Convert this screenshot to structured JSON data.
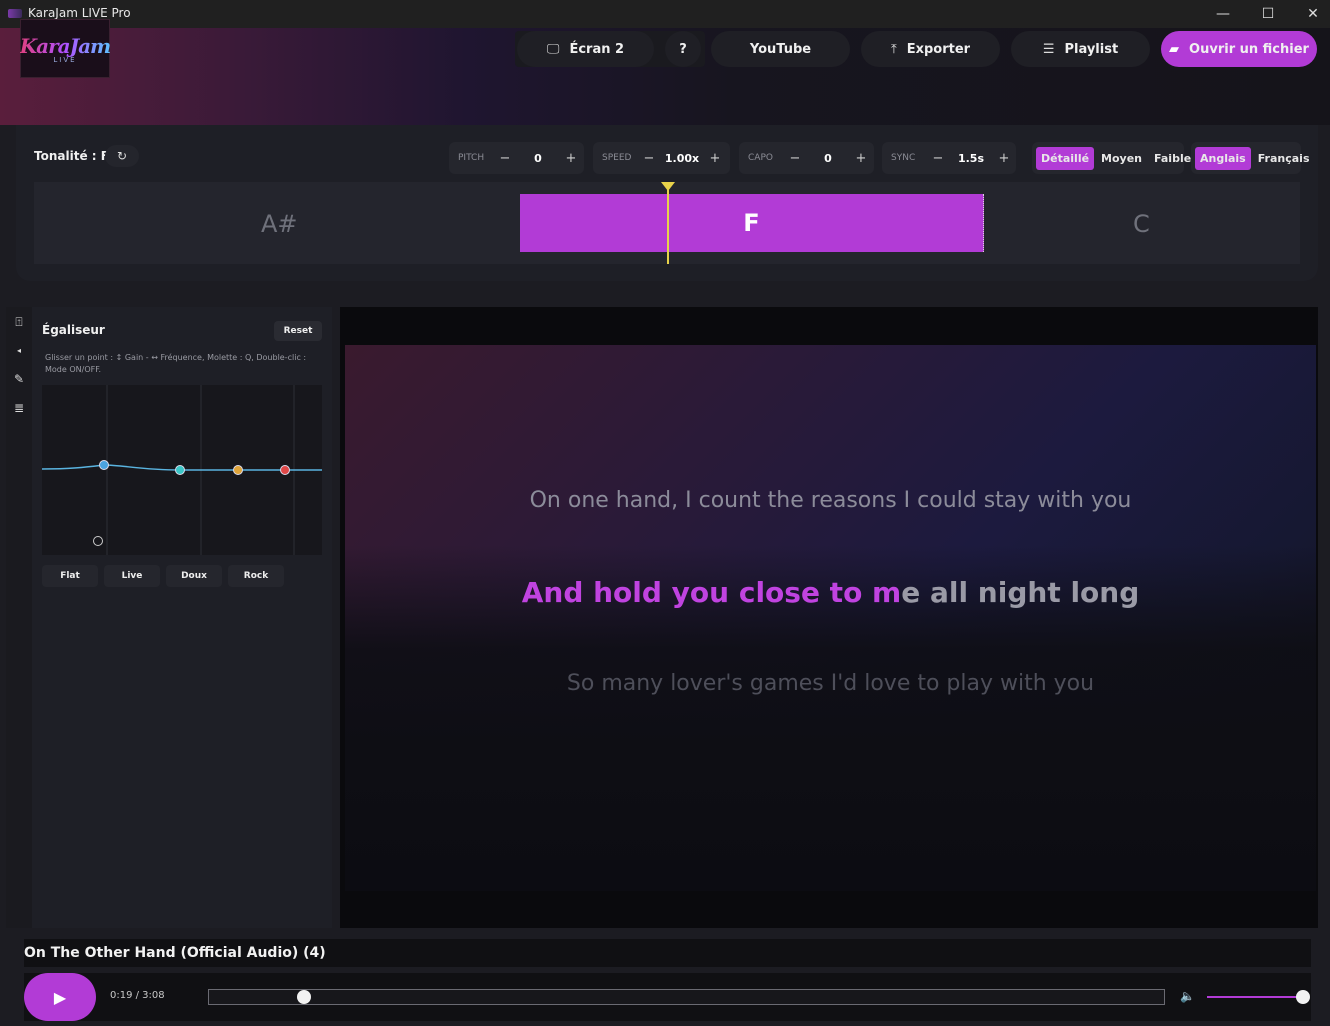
{
  "window": {
    "title": "KaraJam LIVE Pro",
    "minimize": "—",
    "maximize": "☐",
    "close": "✕"
  },
  "logo": {
    "line1": "KaraJam",
    "line2": "LIVE"
  },
  "header": {
    "screen_label": "Écran 2",
    "help_label": "?",
    "youtube_label": "YouTube",
    "export_label": "Exporter",
    "playlist_label": "Playlist",
    "open_label": "Ouvrir un fichier"
  },
  "controls": {
    "tonalite": "Tonalité : F",
    "pitch": {
      "label": "PITCH",
      "value": "0"
    },
    "speed": {
      "label": "SPEED",
      "value": "1.00x"
    },
    "capo": {
      "label": "CAPO",
      "value": "0"
    },
    "sync": {
      "label": "SYNC",
      "value": "1.5s"
    },
    "minus": "−",
    "plus": "+",
    "detail_levels": [
      "Détaillé",
      "Moyen",
      "Faible"
    ],
    "detail_selected": "Détaillé",
    "languages": [
      "Anglais",
      "Français"
    ],
    "language_selected": "Anglais"
  },
  "keys": {
    "prev": "A#",
    "current": "F",
    "next": "C"
  },
  "equalizer": {
    "title": "Égaliseur",
    "reset": "Reset",
    "help": "Glisser un point : ↕ Gain - ↔ Fréquence, Molette : Q, Double-clic : Mode ON/OFF.",
    "presets": [
      "Flat",
      "Live",
      "Doux",
      "Rock"
    ],
    "bands": [
      {
        "color": "#4aa3e0"
      },
      {
        "color": "#3bc7c7"
      },
      {
        "color": "#e0a53b"
      },
      {
        "color": "#e04848"
      }
    ]
  },
  "lyrics": {
    "previous": "On one hand, I count the reasons I could stay with you",
    "current_sung": "And hold you close to m",
    "current_rest": "e all night long",
    "next": "So many lover's games I'd love to play with you"
  },
  "player": {
    "song_title": "On The Other Hand (Official Audio) (4)",
    "time": "0:19 / 3:08",
    "progress": 0.1,
    "volume": 1.0
  },
  "colors": {
    "accent": "#b23bd6",
    "playhead": "#e8d24a"
  }
}
